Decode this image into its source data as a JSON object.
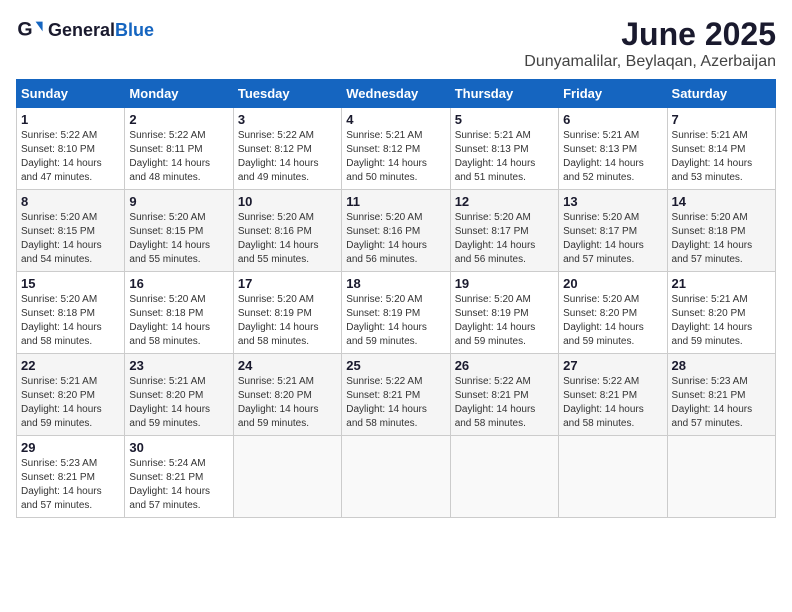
{
  "app": {
    "name_general": "General",
    "name_blue": "Blue"
  },
  "header": {
    "month_year": "June 2025",
    "location": "Dunyamalilar, Beylaqan, Azerbaijan"
  },
  "calendar": {
    "days_of_week": [
      "Sunday",
      "Monday",
      "Tuesday",
      "Wednesday",
      "Thursday",
      "Friday",
      "Saturday"
    ],
    "weeks": [
      [
        null,
        {
          "day": "2",
          "sunrise": "Sunrise: 5:22 AM",
          "sunset": "Sunset: 8:11 PM",
          "daylight": "Daylight: 14 hours and 48 minutes."
        },
        {
          "day": "3",
          "sunrise": "Sunrise: 5:22 AM",
          "sunset": "Sunset: 8:12 PM",
          "daylight": "Daylight: 14 hours and 49 minutes."
        },
        {
          "day": "4",
          "sunrise": "Sunrise: 5:21 AM",
          "sunset": "Sunset: 8:12 PM",
          "daylight": "Daylight: 14 hours and 50 minutes."
        },
        {
          "day": "5",
          "sunrise": "Sunrise: 5:21 AM",
          "sunset": "Sunset: 8:13 PM",
          "daylight": "Daylight: 14 hours and 51 minutes."
        },
        {
          "day": "6",
          "sunrise": "Sunrise: 5:21 AM",
          "sunset": "Sunset: 8:13 PM",
          "daylight": "Daylight: 14 hours and 52 minutes."
        },
        {
          "day": "7",
          "sunrise": "Sunrise: 5:21 AM",
          "sunset": "Sunset: 8:14 PM",
          "daylight": "Daylight: 14 hours and 53 minutes."
        }
      ],
      [
        {
          "day": "8",
          "sunrise": "Sunrise: 5:20 AM",
          "sunset": "Sunset: 8:15 PM",
          "daylight": "Daylight: 14 hours and 54 minutes."
        },
        {
          "day": "9",
          "sunrise": "Sunrise: 5:20 AM",
          "sunset": "Sunset: 8:15 PM",
          "daylight": "Daylight: 14 hours and 55 minutes."
        },
        {
          "day": "10",
          "sunrise": "Sunrise: 5:20 AM",
          "sunset": "Sunset: 8:16 PM",
          "daylight": "Daylight: 14 hours and 55 minutes."
        },
        {
          "day": "11",
          "sunrise": "Sunrise: 5:20 AM",
          "sunset": "Sunset: 8:16 PM",
          "daylight": "Daylight: 14 hours and 56 minutes."
        },
        {
          "day": "12",
          "sunrise": "Sunrise: 5:20 AM",
          "sunset": "Sunset: 8:17 PM",
          "daylight": "Daylight: 14 hours and 56 minutes."
        },
        {
          "day": "13",
          "sunrise": "Sunrise: 5:20 AM",
          "sunset": "Sunset: 8:17 PM",
          "daylight": "Daylight: 14 hours and 57 minutes."
        },
        {
          "day": "14",
          "sunrise": "Sunrise: 5:20 AM",
          "sunset": "Sunset: 8:18 PM",
          "daylight": "Daylight: 14 hours and 57 minutes."
        }
      ],
      [
        {
          "day": "15",
          "sunrise": "Sunrise: 5:20 AM",
          "sunset": "Sunset: 8:18 PM",
          "daylight": "Daylight: 14 hours and 58 minutes."
        },
        {
          "day": "16",
          "sunrise": "Sunrise: 5:20 AM",
          "sunset": "Sunset: 8:18 PM",
          "daylight": "Daylight: 14 hours and 58 minutes."
        },
        {
          "day": "17",
          "sunrise": "Sunrise: 5:20 AM",
          "sunset": "Sunset: 8:19 PM",
          "daylight": "Daylight: 14 hours and 58 minutes."
        },
        {
          "day": "18",
          "sunrise": "Sunrise: 5:20 AM",
          "sunset": "Sunset: 8:19 PM",
          "daylight": "Daylight: 14 hours and 59 minutes."
        },
        {
          "day": "19",
          "sunrise": "Sunrise: 5:20 AM",
          "sunset": "Sunset: 8:19 PM",
          "daylight": "Daylight: 14 hours and 59 minutes."
        },
        {
          "day": "20",
          "sunrise": "Sunrise: 5:20 AM",
          "sunset": "Sunset: 8:20 PM",
          "daylight": "Daylight: 14 hours and 59 minutes."
        },
        {
          "day": "21",
          "sunrise": "Sunrise: 5:21 AM",
          "sunset": "Sunset: 8:20 PM",
          "daylight": "Daylight: 14 hours and 59 minutes."
        }
      ],
      [
        {
          "day": "22",
          "sunrise": "Sunrise: 5:21 AM",
          "sunset": "Sunset: 8:20 PM",
          "daylight": "Daylight: 14 hours and 59 minutes."
        },
        {
          "day": "23",
          "sunrise": "Sunrise: 5:21 AM",
          "sunset": "Sunset: 8:20 PM",
          "daylight": "Daylight: 14 hours and 59 minutes."
        },
        {
          "day": "24",
          "sunrise": "Sunrise: 5:21 AM",
          "sunset": "Sunset: 8:20 PM",
          "daylight": "Daylight: 14 hours and 59 minutes."
        },
        {
          "day": "25",
          "sunrise": "Sunrise: 5:22 AM",
          "sunset": "Sunset: 8:21 PM",
          "daylight": "Daylight: 14 hours and 58 minutes."
        },
        {
          "day": "26",
          "sunrise": "Sunrise: 5:22 AM",
          "sunset": "Sunset: 8:21 PM",
          "daylight": "Daylight: 14 hours and 58 minutes."
        },
        {
          "day": "27",
          "sunrise": "Sunrise: 5:22 AM",
          "sunset": "Sunset: 8:21 PM",
          "daylight": "Daylight: 14 hours and 58 minutes."
        },
        {
          "day": "28",
          "sunrise": "Sunrise: 5:23 AM",
          "sunset": "Sunset: 8:21 PM",
          "daylight": "Daylight: 14 hours and 57 minutes."
        }
      ],
      [
        {
          "day": "29",
          "sunrise": "Sunrise: 5:23 AM",
          "sunset": "Sunset: 8:21 PM",
          "daylight": "Daylight: 14 hours and 57 minutes."
        },
        {
          "day": "30",
          "sunrise": "Sunrise: 5:24 AM",
          "sunset": "Sunset: 8:21 PM",
          "daylight": "Daylight: 14 hours and 57 minutes."
        },
        null,
        null,
        null,
        null,
        null
      ]
    ],
    "first_week_first_cell": {
      "day": "1",
      "sunrise": "Sunrise: 5:22 AM",
      "sunset": "Sunset: 8:10 PM",
      "daylight": "Daylight: 14 hours and 47 minutes."
    }
  }
}
